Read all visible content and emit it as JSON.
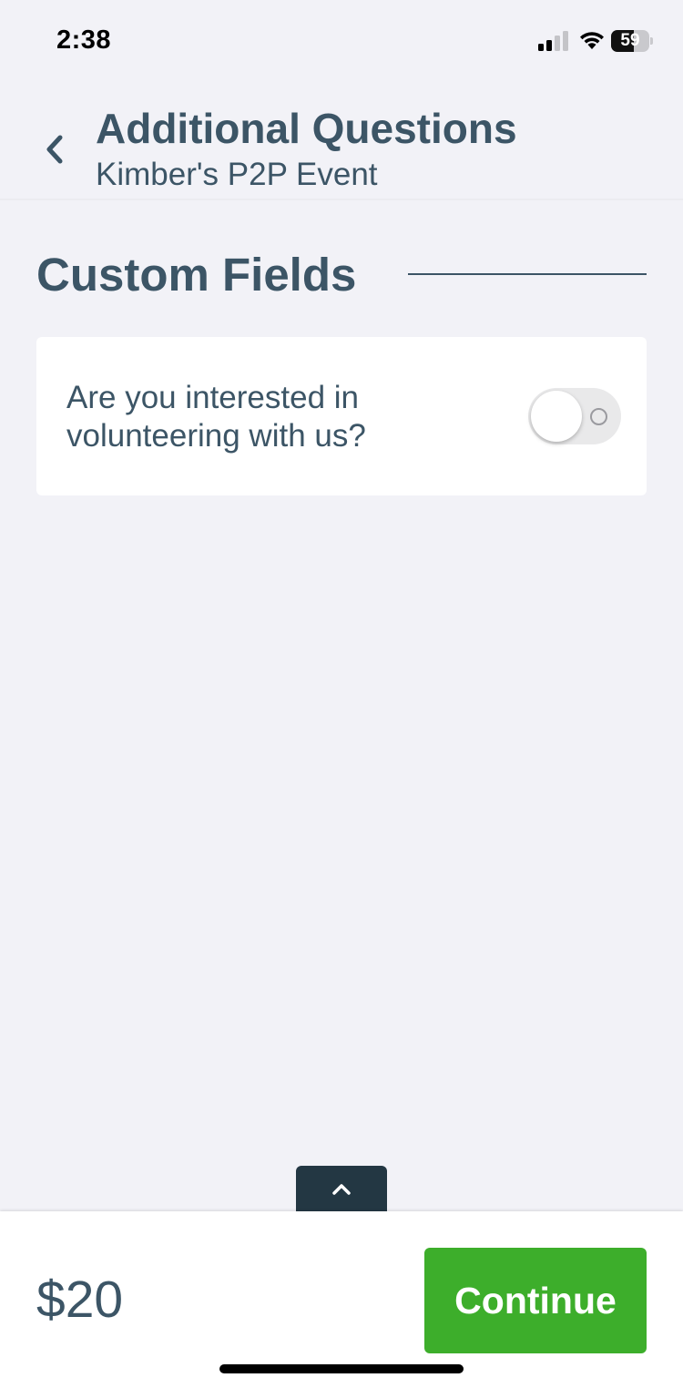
{
  "status_bar": {
    "time": "2:38",
    "battery_level": "59",
    "battery_percent": 59
  },
  "header": {
    "title": "Additional Questions",
    "subtitle": "Kimber's P2P Event",
    "back_icon": "chevron-left-icon"
  },
  "section": {
    "title": "Custom Fields"
  },
  "custom_fields": [
    {
      "label": "Are you interested in volunteering with us?",
      "toggle_on": false
    }
  ],
  "expand_tab": {
    "icon": "chevron-up-icon"
  },
  "footer": {
    "total": "$20",
    "continue_label": "Continue"
  },
  "colors": {
    "primary_text": "#3c5566",
    "accent_green": "#3dae2b",
    "dark_tab": "#233743",
    "background": "#f2f2f7"
  }
}
